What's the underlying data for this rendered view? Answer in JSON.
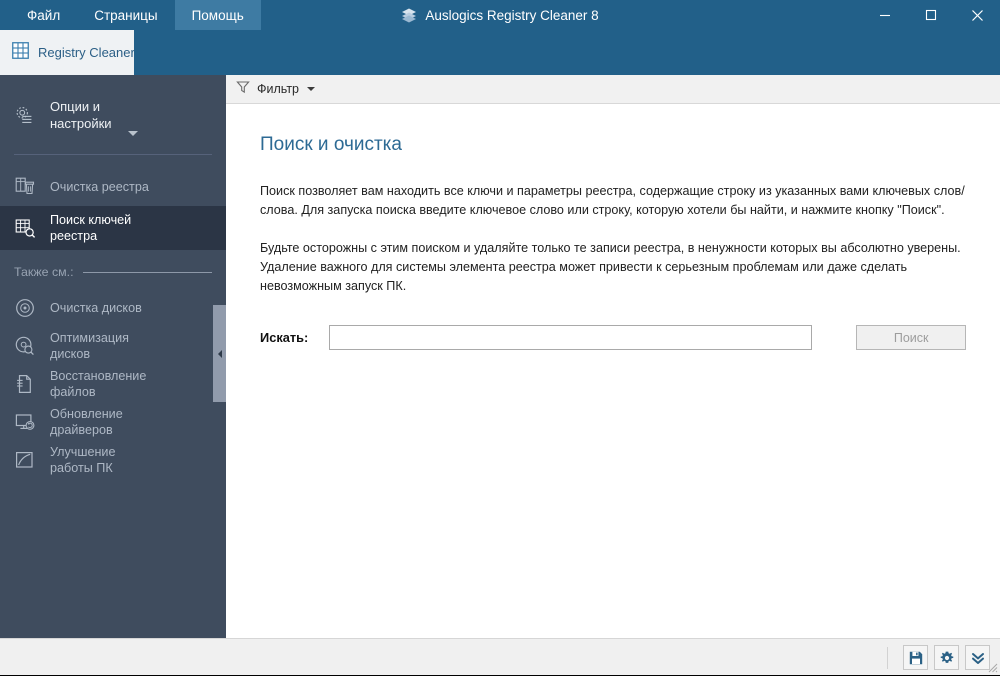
{
  "window": {
    "title": "Auslogics Registry Cleaner 8",
    "logo_icon": "auslogics-layers-icon",
    "minimize_icon": "minimize-icon",
    "maximize_icon": "maximize-icon",
    "close_icon": "close-icon",
    "accent_blue": "#226089",
    "sidebar_bg": "#3f4c5e",
    "selected_bg": "#2b3545",
    "title_link_color": "#2d6a94"
  },
  "menu": {
    "items": [
      {
        "label": "Файл",
        "active": false
      },
      {
        "label": "Страницы",
        "active": false
      },
      {
        "label": "Помощь",
        "active": true
      }
    ]
  },
  "tabs": [
    {
      "label": "Registry Cleaner",
      "icon": "grid-icon",
      "active": true
    }
  ],
  "sidebar": {
    "options": {
      "label": "Опции и\nнастройки",
      "icon": "gear-list-icon",
      "caret": "chevron-down-icon"
    },
    "items": [
      {
        "label": "Очистка реестра",
        "icon": "registry-clean-icon",
        "selected": false
      },
      {
        "label": "Поиск ключей\nреестра",
        "icon": "registry-search-icon",
        "selected": true
      }
    ],
    "also_see_label": "Также см.:",
    "also_see_items": [
      {
        "label": "Очистка дисков",
        "icon": "disk-clean-icon"
      },
      {
        "label": "Оптимизация\nдисков",
        "icon": "disk-optimize-icon"
      },
      {
        "label": "Восстановление\nфайлов",
        "icon": "file-recovery-icon"
      },
      {
        "label": "Обновление\nдрайверов",
        "icon": "driver-update-icon"
      },
      {
        "label": "Улучшение\nработы ПК",
        "icon": "pc-boost-icon"
      }
    ],
    "collapse_handle_icon": "chevron-left-icon"
  },
  "content": {
    "filter": {
      "label": "Фильтр",
      "icon": "funnel-icon",
      "caret": "chevron-down-icon"
    },
    "page_title": "Поиск и очистка",
    "paragraphs": [
      "Поиск позволяет вам находить все ключи и параметры реестра, содержащие строку из указанных вами ключевых слов/слова. Для запуска поиска введите ключевое слово или строку, которую хотели бы найти, и нажмите кнопку \"Поиск\".",
      "Будьте осторожны с этим поиском и удаляйте только те записи реестра, в ненужности которых вы абсолютно уверены. Удаление важного для системы элемента реестра может привести к серьезным проблемам или даже сделать невозможным запуск ПК."
    ],
    "search": {
      "label": "Искать:",
      "value": "",
      "placeholder": "",
      "button_label": "Поиск",
      "button_disabled": true
    }
  },
  "statusbar": {
    "buttons": [
      {
        "icon": "save-icon",
        "name": "save-button"
      },
      {
        "icon": "gear-icon",
        "name": "settings-button"
      },
      {
        "icon": "double-chevron-down-icon",
        "name": "expand-button"
      }
    ]
  }
}
